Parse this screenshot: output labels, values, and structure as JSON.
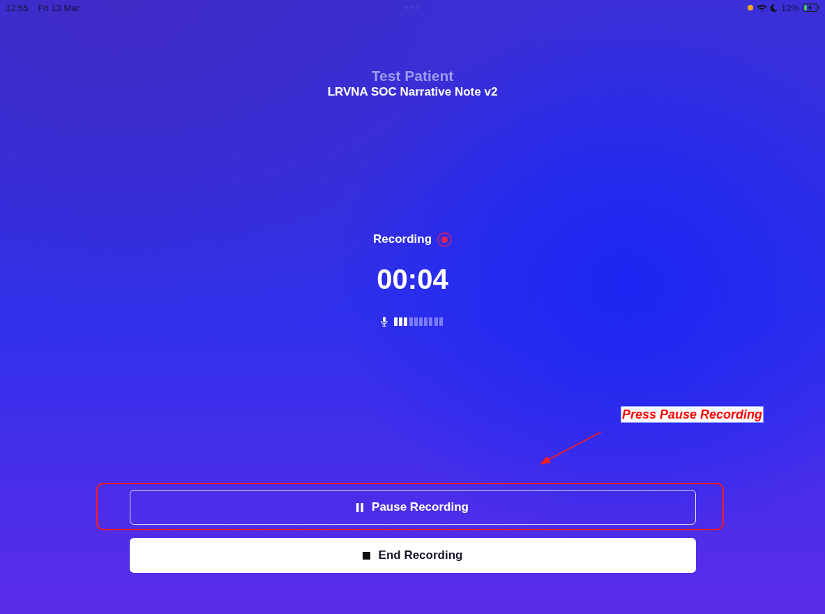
{
  "status_bar": {
    "time": "12:55",
    "date": "Fri 13 Mar",
    "battery": "12%"
  },
  "header": {
    "patient": "Test Patient",
    "note_title": "LRVNA SOC Narrative Note v2"
  },
  "recorder": {
    "status": "Recording",
    "timer": "00:04",
    "input_level": {
      "level": 0.3
    }
  },
  "buttons": [
    {
      "kind": "pause",
      "label": "Pause Recording",
      "highlighted": true
    },
    {
      "kind": "end",
      "label": "End Recording",
      "highlighted": false
    }
  ],
  "callout": {
    "text": "Press Pause Recording"
  }
}
